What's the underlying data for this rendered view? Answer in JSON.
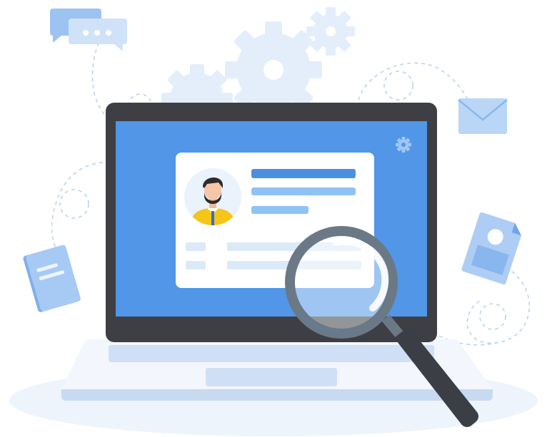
{
  "illustration": {
    "subject": "laptop-profile-search",
    "palette": {
      "accent_blue": "#4a90e2",
      "screen_blue": "#5196e7",
      "bar_dark": "#4b8fe3",
      "bar_light": "#8fc2f5",
      "light_blue": "#b9d6f7",
      "pale_blue": "#dce9f8",
      "gear_blue": "#e4eefb",
      "laptop_frame": "#3d3f45",
      "lens_rim": "#6b7886",
      "handle": "#3b3e44",
      "tie_blue": "#2f6fd6",
      "jacket_yellow": "#f5c518"
    },
    "icons": [
      "chat-bubble-icon",
      "gear-icon",
      "envelope-icon",
      "document-icon",
      "image-file-icon",
      "magnifying-glass-icon",
      "avatar-icon"
    ]
  }
}
